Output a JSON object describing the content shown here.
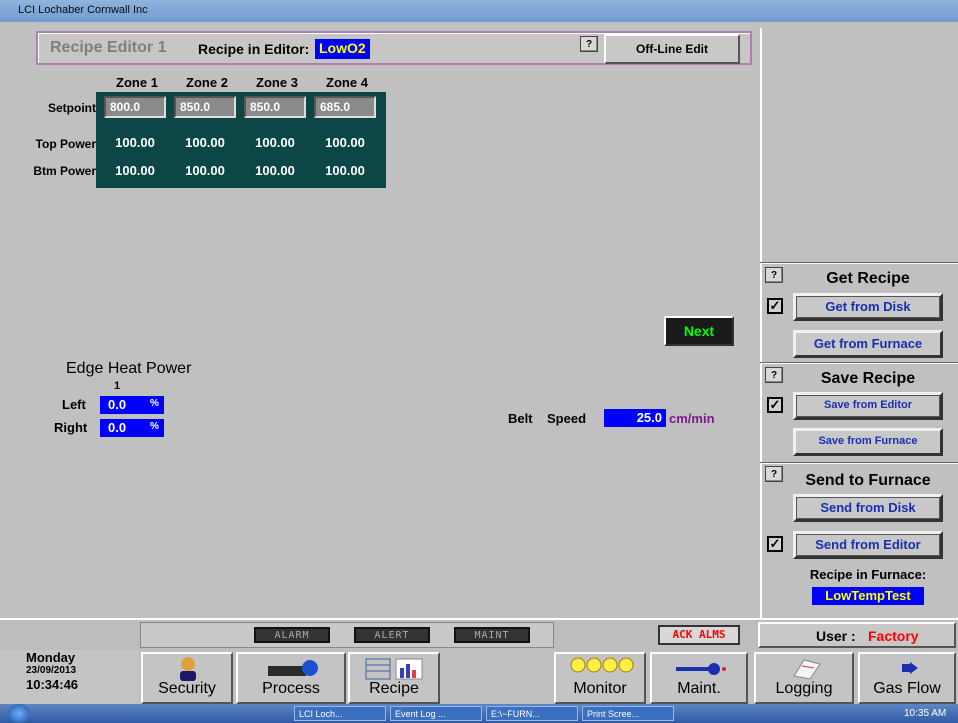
{
  "window": {
    "title": "LCI Lochaber Cornwall Inc"
  },
  "header": {
    "title": "Recipe Editor 1",
    "recipe_label": "Recipe in Editor:",
    "recipe_name": "LowO2",
    "help": "?",
    "offline_button": "Off-Line Edit"
  },
  "zones": {
    "headers": [
      "Zone 1",
      "Zone 2",
      "Zone 3",
      "Zone 4"
    ],
    "setpoint_label": "Setpoint",
    "setpoints": [
      "800.0",
      "850.0",
      "850.0",
      "685.0"
    ],
    "top_power_label": "Top Power",
    "top_power": [
      "100.00",
      "100.00",
      "100.00",
      "100.00"
    ],
    "btm_power_label": "Btm Power",
    "btm_power": [
      "100.00",
      "100.00",
      "100.00",
      "100.00"
    ]
  },
  "next_button": "Next",
  "edge_heat": {
    "title": "Edge Heat Power",
    "index": "1",
    "left_label": "Left",
    "left_value": "0.0",
    "right_label": "Right",
    "right_value": "0.0",
    "unit": "%"
  },
  "belt": {
    "label1": "Belt",
    "label2": "Speed",
    "value": "25.0",
    "unit": "cm/min"
  },
  "get_recipe": {
    "title": "Get Recipe",
    "from_disk": "Get from Disk",
    "from_furnace": "Get from Furnace",
    "help": "?"
  },
  "save_recipe": {
    "title": "Save Recipe",
    "from_editor": "Save from Editor",
    "from_furnace": "Save from Furnace",
    "help": "?"
  },
  "send_furnace": {
    "title": "Send to Furnace",
    "from_disk": "Send from Disk",
    "from_editor": "Send from Editor",
    "help": "?",
    "in_furnace_label": "Recipe in Furnace:",
    "in_furnace_value": "LowTempTest"
  },
  "alarms": {
    "alarm": "ALARM",
    "alert": "ALERT",
    "maint": "MAINT",
    "ack": "ACK ALMS"
  },
  "user": {
    "label": "User :",
    "name": "Factory"
  },
  "datetime": {
    "day": "Monday",
    "date": "23/09/2013",
    "time": "10:34:46"
  },
  "nav": {
    "security": "Security",
    "process": "Process",
    "recipe": "Recipe",
    "monitor": "Monitor",
    "maint": "Maint.",
    "logging": "Logging",
    "gasflow": "Gas Flow"
  },
  "taskbar": {
    "items": [
      "LCI Loch...",
      "Event Log ...",
      "E:\\~FURN...",
      "Print Scree..."
    ],
    "clock": "10:35 AM"
  },
  "colors": {
    "accent_blue": "#0000ff",
    "ack_red": "#ff0000",
    "grid_teal": "#0d4646",
    "next_green": "#00ff00"
  }
}
